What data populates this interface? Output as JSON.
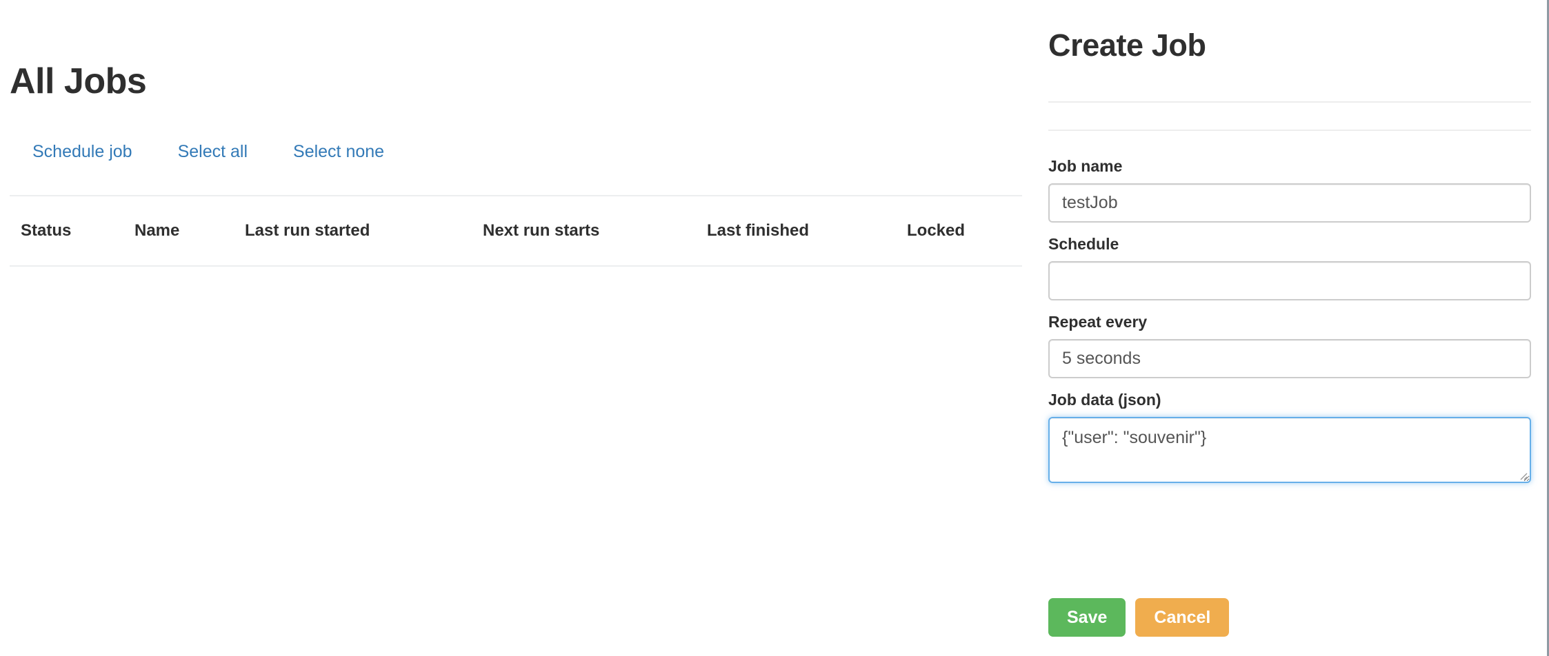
{
  "jobs_panel": {
    "title": "All Jobs",
    "actions": [
      {
        "label": "Schedule job",
        "name": "schedule-job-link"
      },
      {
        "label": "Select all",
        "name": "select-all-link"
      },
      {
        "label": "Select none",
        "name": "select-none-link"
      }
    ],
    "table": {
      "columns": [
        "Status",
        "Name",
        "Last run started",
        "Next run starts",
        "Last finished",
        "Locked"
      ],
      "rows": []
    }
  },
  "create_job_panel": {
    "title": "Create Job",
    "fields": {
      "job_name": {
        "label": "Job name",
        "value": "testJob",
        "placeholder": ""
      },
      "schedule": {
        "label": "Schedule",
        "value": "",
        "placeholder": ""
      },
      "repeat_every": {
        "label": "Repeat every",
        "value": "5 seconds",
        "placeholder": ""
      },
      "job_data": {
        "label": "Job data (json)",
        "value": "{\"user\": \"souvenir\"}",
        "placeholder": "",
        "focused": true
      }
    },
    "buttons": {
      "save": "Save",
      "cancel": "Cancel"
    }
  },
  "colors": {
    "link": "#337ab7",
    "save_green": "#5cb85c",
    "cancel_orange": "#f0ad4e",
    "focus_blue": "#66afe9",
    "rule_gray": "#ededed",
    "divider_gray": "#dcdcdc",
    "text_dark": "#2f2f2f"
  }
}
